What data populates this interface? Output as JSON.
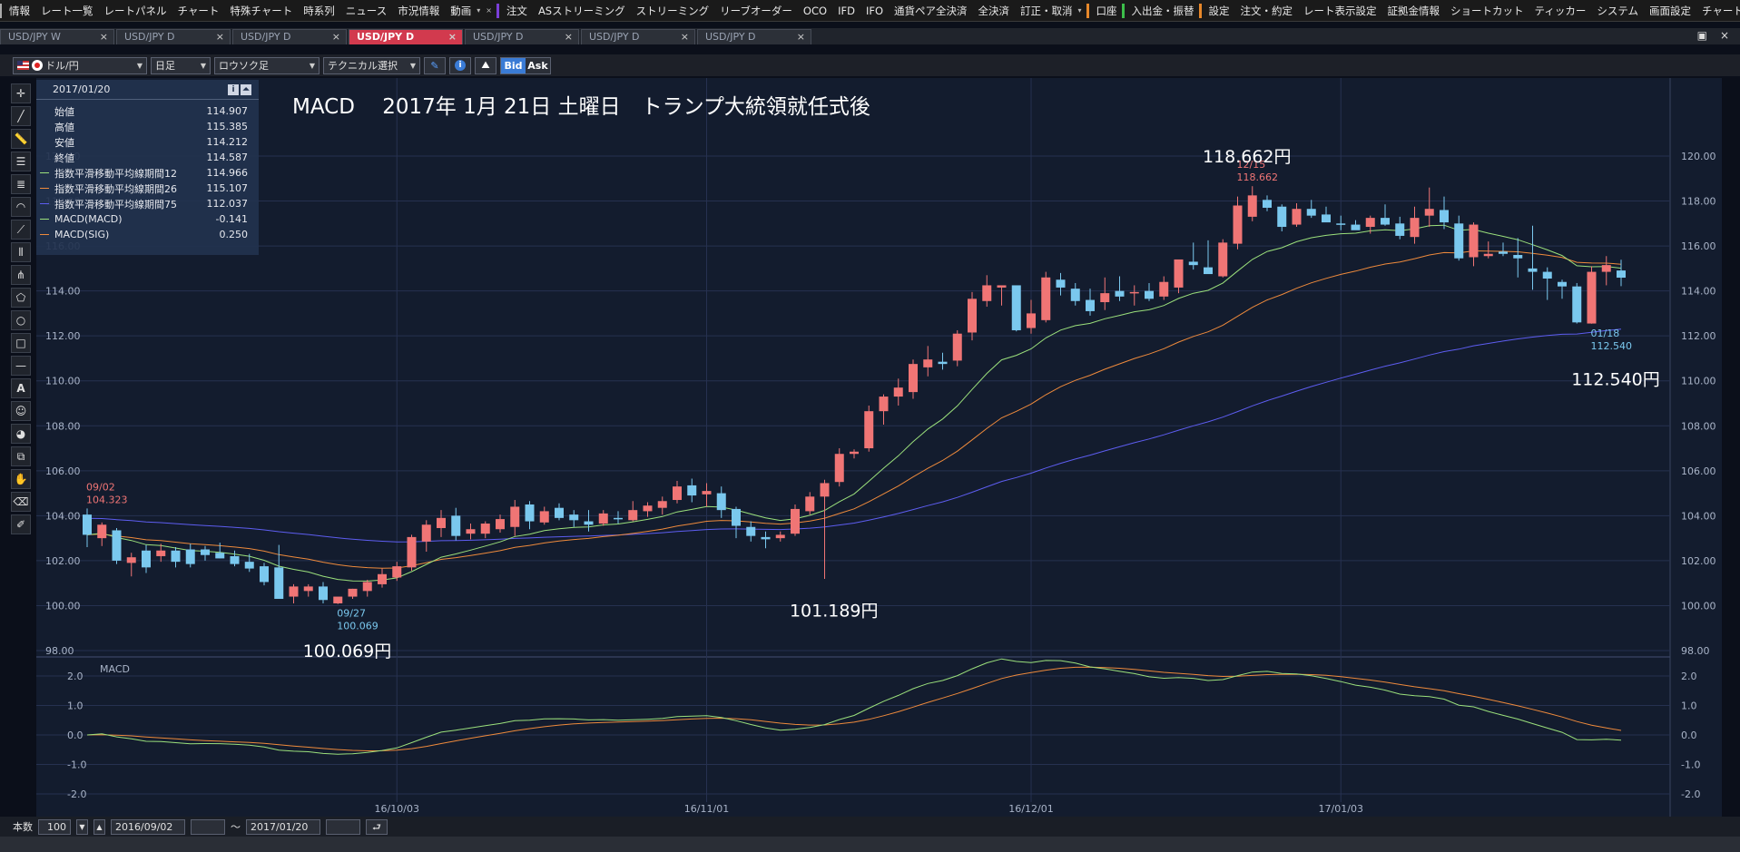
{
  "menubar": {
    "groups": [
      {
        "accent": "#aaaaaa",
        "items": [
          "情報",
          "レート一覧",
          "レートパネル",
          "チャート",
          "特殊チャート",
          "時系列",
          "ニュース",
          "市況情報",
          "動画"
        ],
        "trail": [
          "▾",
          "×"
        ]
      },
      {
        "accent": "#7a3fd8",
        "items": [
          "注文",
          "ASストリーミング",
          "ストリーミング",
          "リーブオーダー",
          "OCO",
          "IFD",
          "IFO",
          "通貨ペア全決済",
          "全決済",
          "訂正・取消"
        ],
        "trail": [
          "▾"
        ]
      },
      {
        "accent": "#e8882a",
        "items": [
          "口座"
        ],
        "trail": []
      },
      {
        "accent": "#3cbf4a",
        "items": [
          "入出金・振替"
        ],
        "trail": []
      },
      {
        "accent": "#e8882a",
        "items": [
          "設定",
          "注文・約定",
          "レート表示設定",
          "証拠金情報",
          "ショートカット",
          "ティッカー",
          "システム",
          "画面設定",
          "チャート"
        ],
        "trail": []
      }
    ]
  },
  "tabs": [
    {
      "label": "USD/JPY W",
      "active": false
    },
    {
      "label": "USD/JPY D",
      "active": false
    },
    {
      "label": "USD/JPY D",
      "active": false
    },
    {
      "label": "USD/JPY D",
      "active": true
    },
    {
      "label": "USD/JPY D",
      "active": false
    },
    {
      "label": "USD/JPY D",
      "active": false
    },
    {
      "label": "USD/JPY D",
      "active": false
    }
  ],
  "tab_close": "×",
  "window_controls": {
    "restore": "▣",
    "close": "×"
  },
  "toolbar": {
    "pair": "ドル/円",
    "timeframe": "日足",
    "chart_type": "ロウソク足",
    "technical": "テクニカル選択",
    "bid": "Bid",
    "ask": "Ask"
  },
  "info_panel": {
    "date": "2017/01/20",
    "rows": [
      {
        "label": "始値",
        "value": "114.907",
        "color": ""
      },
      {
        "label": "高値",
        "value": "115.385",
        "color": ""
      },
      {
        "label": "安値",
        "value": "114.212",
        "color": ""
      },
      {
        "label": "終値",
        "value": "114.587",
        "color": ""
      },
      {
        "label": "指数平滑移動平均線期間12",
        "value": "114.966",
        "color": "#9be07c"
      },
      {
        "label": "指数平滑移動平均線期間26",
        "value": "115.107",
        "color": "#ee8a3c"
      },
      {
        "label": "指数平滑移動平均線期間75",
        "value": "112.037",
        "color": "#5d5df0"
      },
      {
        "label": "MACD(MACD)",
        "value": "-0.141",
        "color": "#9be07c"
      },
      {
        "label": "MACD(SIG)",
        "value": "0.250",
        "color": "#ee8a3c"
      }
    ]
  },
  "bottom": {
    "count_label": "本数",
    "count": "100",
    "from": "2016/09/02",
    "tilde": "〜",
    "to": "2017/01/20",
    "go_icon": "⮐"
  },
  "chart_data": {
    "type": "candlestick",
    "title": "MACD　 2017年 1月 21日 土曜日　トランプ大統領就任式後",
    "price_axis": {
      "min": 98,
      "max": 120,
      "ticks": [
        "98.00",
        "100.00",
        "102.00",
        "104.00",
        "106.00",
        "108.00",
        "110.00",
        "112.00",
        "114.00",
        "116.00",
        "118.00",
        "120.00"
      ]
    },
    "macd_axis": {
      "min": -2,
      "max": 2,
      "ticks": [
        "-2.0",
        "-1.0",
        "0.0",
        "1.0",
        "2.0"
      ]
    },
    "x_labels": [
      {
        "label": "16/10/03",
        "index": 21
      },
      {
        "label": "16/11/01",
        "index": 42
      },
      {
        "label": "16/12/01",
        "index": 64
      },
      {
        "label": "17/01/03",
        "index": 85
      }
    ],
    "candles": [
      [
        104.05,
        104.32,
        102.6,
        103.15
      ],
      [
        103.0,
        103.7,
        102.65,
        103.6
      ],
      [
        103.35,
        103.45,
        101.85,
        102.0
      ],
      [
        101.9,
        102.35,
        101.3,
        102.15
      ],
      [
        102.45,
        102.7,
        101.45,
        101.7
      ],
      [
        102.2,
        102.75,
        101.95,
        102.45
      ],
      [
        102.45,
        102.6,
        101.7,
        101.95
      ],
      [
        102.5,
        102.75,
        101.7,
        101.85
      ],
      [
        102.5,
        102.65,
        102.0,
        102.25
      ],
      [
        102.35,
        102.8,
        102.1,
        102.1
      ],
      [
        102.2,
        102.45,
        101.75,
        101.85
      ],
      [
        101.95,
        102.3,
        101.5,
        101.65
      ],
      [
        101.75,
        101.9,
        100.9,
        101.05
      ],
      [
        101.7,
        102.7,
        100.4,
        100.3
      ],
      [
        100.4,
        100.95,
        100.1,
        100.85
      ],
      [
        100.65,
        100.95,
        100.4,
        100.85
      ],
      [
        100.85,
        101.05,
        100.1,
        100.25
      ],
      [
        100.1,
        100.2,
        100.07,
        100.4
      ],
      [
        100.4,
        100.75,
        100.3,
        100.75
      ],
      [
        100.65,
        101.15,
        100.4,
        101.05
      ],
      [
        100.95,
        101.65,
        100.8,
        101.4
      ],
      [
        101.25,
        101.95,
        101.1,
        101.75
      ],
      [
        101.7,
        103.15,
        101.55,
        103.05
      ],
      [
        102.85,
        103.8,
        102.4,
        103.6
      ],
      [
        103.45,
        104.25,
        103.05,
        103.9
      ],
      [
        104.0,
        104.35,
        102.9,
        103.1
      ],
      [
        103.2,
        103.65,
        102.95,
        103.4
      ],
      [
        103.2,
        103.75,
        103.0,
        103.65
      ],
      [
        103.4,
        104.05,
        103.25,
        103.85
      ],
      [
        103.5,
        104.7,
        103.1,
        104.4
      ],
      [
        104.5,
        104.65,
        103.4,
        103.75
      ],
      [
        103.7,
        104.4,
        103.6,
        104.2
      ],
      [
        104.35,
        104.55,
        103.8,
        103.9
      ],
      [
        104.05,
        104.25,
        103.5,
        103.8
      ],
      [
        103.75,
        104.25,
        103.3,
        103.6
      ],
      [
        103.65,
        104.25,
        103.55,
        104.1
      ],
      [
        103.9,
        104.2,
        103.65,
        103.85
      ],
      [
        103.8,
        104.65,
        103.75,
        104.25
      ],
      [
        104.2,
        104.6,
        103.95,
        104.45
      ],
      [
        104.35,
        104.85,
        104.05,
        104.65
      ],
      [
        104.7,
        105.55,
        104.55,
        105.3
      ],
      [
        105.35,
        105.65,
        104.6,
        104.9
      ],
      [
        104.95,
        105.45,
        104.4,
        105.1
      ],
      [
        105.0,
        105.3,
        103.9,
        104.25
      ],
      [
        104.3,
        104.4,
        103.0,
        103.55
      ],
      [
        103.5,
        103.75,
        102.85,
        103.1
      ],
      [
        103.05,
        103.3,
        102.55,
        102.95
      ],
      [
        103.0,
        103.3,
        102.85,
        103.15
      ],
      [
        103.2,
        104.5,
        103.1,
        104.3
      ],
      [
        104.2,
        105.05,
        104.05,
        104.85
      ],
      [
        104.85,
        105.6,
        101.19,
        105.45
      ],
      [
        105.5,
        107.0,
        105.3,
        106.75
      ],
      [
        106.75,
        106.95,
        106.55,
        106.85
      ],
      [
        107.0,
        108.9,
        106.85,
        108.65
      ],
      [
        108.65,
        109.4,
        108.05,
        109.3
      ],
      [
        109.3,
        110.1,
        108.9,
        109.7
      ],
      [
        109.5,
        110.95,
        109.2,
        110.75
      ],
      [
        110.6,
        111.55,
        110.2,
        110.95
      ],
      [
        110.85,
        111.25,
        110.5,
        110.75
      ],
      [
        110.9,
        112.25,
        110.65,
        112.1
      ],
      [
        112.15,
        113.95,
        111.8,
        113.65
      ],
      [
        113.55,
        114.7,
        113.3,
        114.25
      ],
      [
        114.15,
        114.25,
        113.35,
        114.25
      ],
      [
        114.25,
        114.15,
        112.2,
        112.25
      ],
      [
        112.35,
        113.6,
        112.1,
        113.0
      ],
      [
        112.7,
        114.85,
        112.6,
        114.6
      ],
      [
        114.5,
        114.8,
        113.8,
        114.15
      ],
      [
        114.1,
        114.35,
        113.35,
        113.55
      ],
      [
        113.6,
        114.1,
        112.9,
        113.1
      ],
      [
        113.5,
        114.6,
        113.15,
        113.9
      ],
      [
        114.0,
        114.65,
        113.55,
        113.75
      ],
      [
        113.9,
        114.25,
        113.35,
        113.95
      ],
      [
        114.0,
        114.35,
        113.55,
        113.65
      ],
      [
        113.75,
        114.65,
        113.6,
        114.4
      ],
      [
        114.15,
        115.35,
        113.9,
        115.4
      ],
      [
        115.3,
        116.15,
        114.95,
        115.15
      ],
      [
        115.05,
        116.25,
        114.9,
        114.75
      ],
      [
        114.65,
        116.3,
        114.6,
        116.15
      ],
      [
        116.1,
        118.2,
        115.85,
        117.8
      ],
      [
        117.3,
        118.66,
        117.1,
        118.25
      ],
      [
        118.05,
        118.25,
        117.55,
        117.7
      ],
      [
        117.75,
        117.85,
        116.65,
        116.85
      ],
      [
        116.95,
        117.9,
        116.85,
        117.65
      ],
      [
        117.65,
        118.05,
        117.25,
        117.35
      ],
      [
        117.4,
        117.75,
        117.1,
        117.05
      ],
      [
        117.0,
        117.35,
        116.7,
        116.95
      ],
      [
        116.95,
        117.15,
        116.75,
        116.7
      ],
      [
        116.85,
        117.35,
        116.55,
        117.25
      ],
      [
        117.25,
        117.85,
        116.9,
        116.95
      ],
      [
        117.0,
        117.3,
        116.3,
        116.45
      ],
      [
        116.4,
        117.75,
        116.1,
        117.25
      ],
      [
        117.35,
        118.6,
        116.85,
        117.65
      ],
      [
        117.6,
        118.2,
        116.75,
        117.05
      ],
      [
        117.0,
        117.35,
        115.35,
        115.45
      ],
      [
        115.5,
        117.05,
        115.1,
        116.95
      ],
      [
        115.55,
        116.2,
        115.45,
        115.65
      ],
      [
        115.75,
        116.15,
        115.55,
        115.65
      ],
      [
        115.6,
        116.35,
        114.6,
        115.45
      ],
      [
        115.0,
        116.9,
        114.05,
        114.85
      ],
      [
        114.85,
        115.05,
        113.6,
        114.55
      ],
      [
        114.4,
        114.5,
        113.65,
        114.2
      ],
      [
        114.2,
        114.35,
        112.55,
        112.6
      ],
      [
        112.55,
        115.1,
        112.54,
        114.85
      ],
      [
        114.85,
        115.55,
        114.25,
        115.15
      ],
      [
        114.91,
        115.39,
        114.21,
        114.59
      ]
    ],
    "annotations": [
      {
        "date": "09/02",
        "price": "104.323",
        "at": [
          0,
          104.32
        ],
        "color": "#f07575"
      },
      {
        "date": "09/27",
        "price": "100.069",
        "at": [
          17,
          100.07
        ],
        "color": "#7ac8ee"
      },
      {
        "date": "12/15",
        "price": "118.662",
        "at": [
          78,
          118.66
        ],
        "color": "#f07575"
      },
      {
        "date": "01/18",
        "price": "112.540",
        "at": [
          102,
          112.54
        ],
        "color": "#7ac8ee"
      }
    ],
    "callouts": [
      {
        "text": "100.069円",
        "at": [
          18,
          98.0
        ]
      },
      {
        "text": "101.189円",
        "at": [
          51,
          99.8
        ]
      },
      {
        "text": "118.662円",
        "at": [
          79,
          120.0
        ]
      },
      {
        "text": "112.540円",
        "at": [
          104,
          110.1
        ]
      }
    ],
    "ema12_color": "#9be07c",
    "ema26_color": "#ee8a3c",
    "ema75_color": "#5d5df0",
    "up_color": "#f07575",
    "down_color": "#7ac8ee",
    "macd_label": "MACD"
  }
}
